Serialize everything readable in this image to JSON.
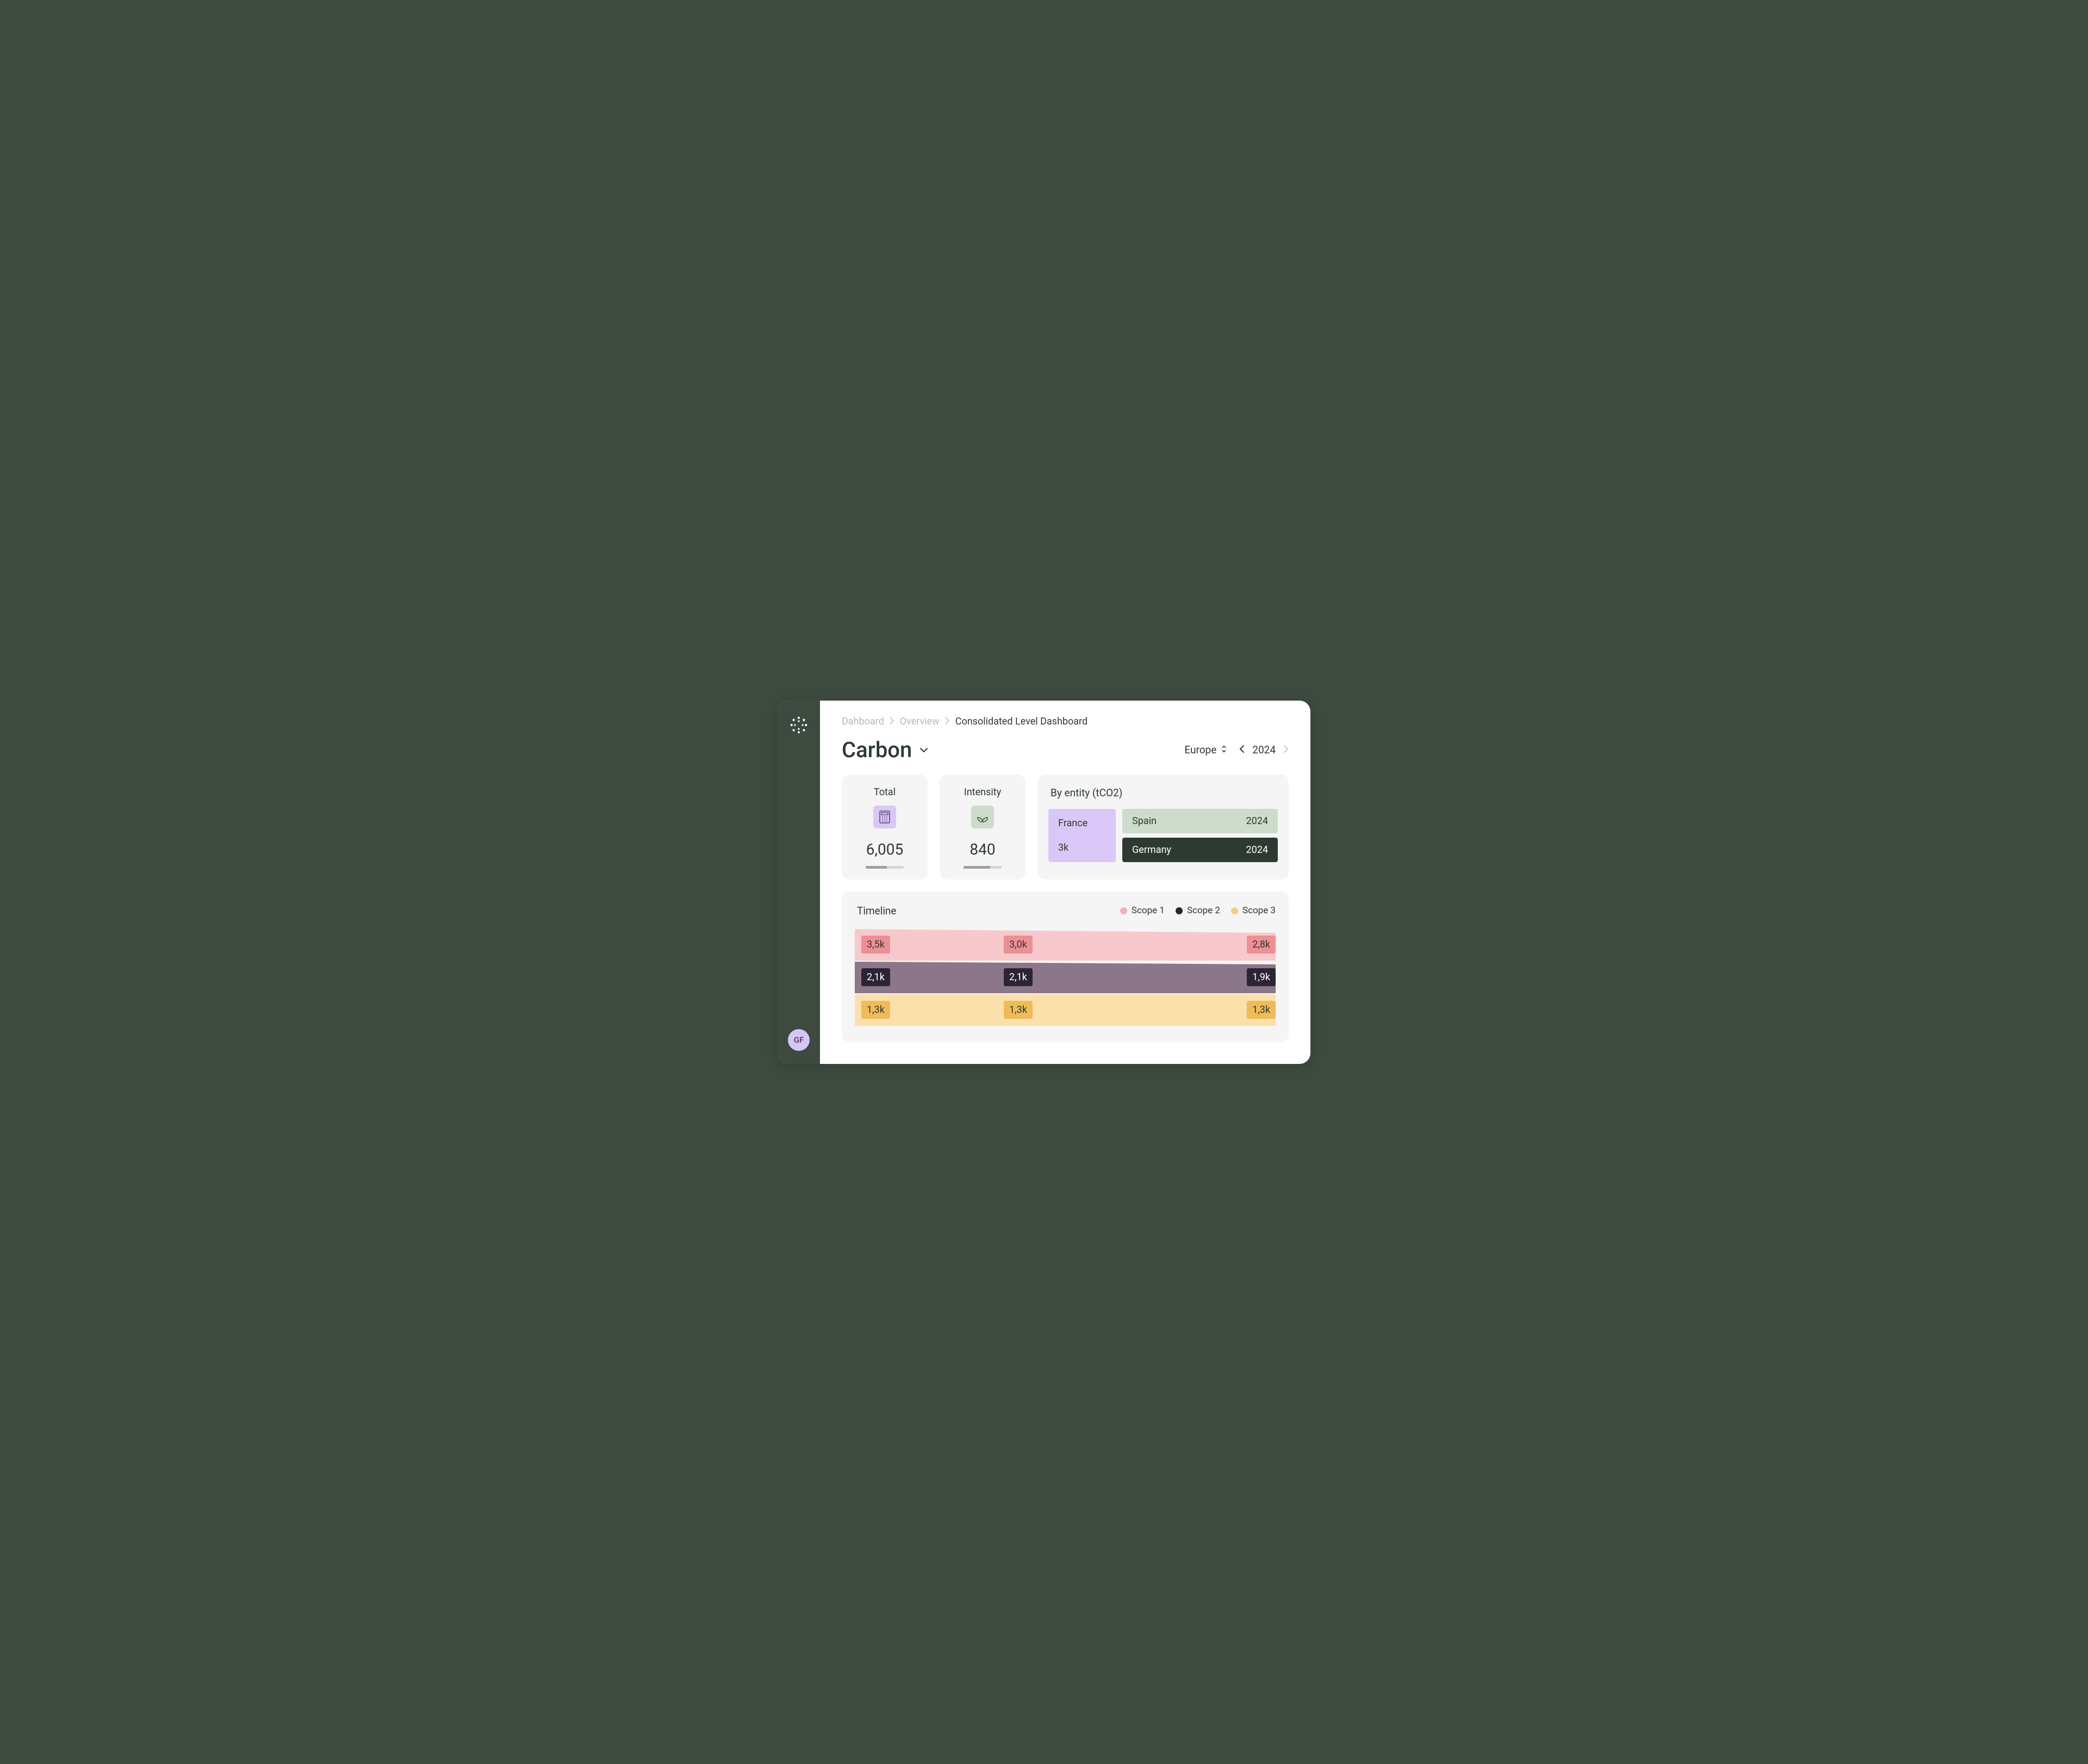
{
  "sidebar": {
    "avatar_initials": "GF"
  },
  "breadcrumb": {
    "items": [
      "Dahboard",
      "Overview",
      "Consolidated Level Dashboard"
    ]
  },
  "header": {
    "title": "Carbon",
    "region": "Europe",
    "year": "2024"
  },
  "metrics": {
    "total": {
      "label": "Total",
      "value": "6,005",
      "fill_pct": 55
    },
    "intensity": {
      "label": "Intensity",
      "value": "840",
      "fill_pct": 70
    }
  },
  "entity": {
    "title": "By entity (tCO2)",
    "primary": {
      "name": "France",
      "value": "3k"
    },
    "rows": [
      {
        "name": "Spain",
        "year": "2024",
        "style": "light"
      },
      {
        "name": "Germany",
        "year": "2024",
        "style": "dark"
      }
    ]
  },
  "timeline": {
    "title": "Timeline",
    "legend": [
      {
        "label": "Scope 1",
        "color": "pink"
      },
      {
        "label": "Scope 2",
        "color": "dark"
      },
      {
        "label": "Scope 3",
        "color": "yellow"
      }
    ],
    "scope1": [
      "3,5k",
      "3,0k",
      "2,8k"
    ],
    "scope2": [
      "2,1k",
      "2,1k",
      "1,9k"
    ],
    "scope3": [
      "1,3k",
      "1,3k",
      "1,3k"
    ]
  },
  "chart_data": {
    "type": "area",
    "title": "Timeline",
    "series": [
      {
        "name": "Scope 1",
        "values": [
          3.5,
          3.0,
          2.8
        ],
        "unit": "k"
      },
      {
        "name": "Scope 2",
        "values": [
          2.1,
          2.1,
          1.9
        ],
        "unit": "k"
      },
      {
        "name": "Scope 3",
        "values": [
          1.3,
          1.3,
          1.3
        ],
        "unit": "k"
      }
    ]
  }
}
